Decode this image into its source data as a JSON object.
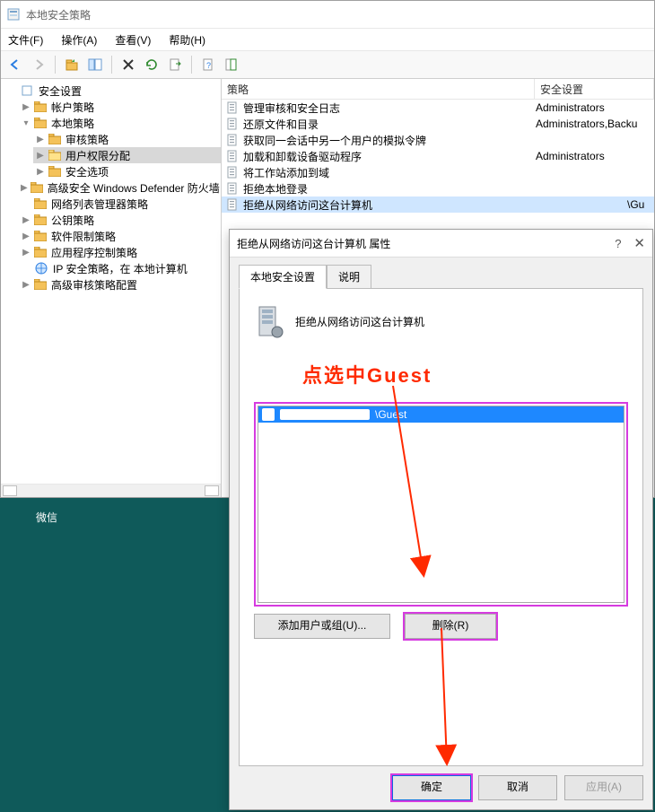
{
  "window": {
    "title": "本地安全策略",
    "menus": {
      "file": "文件(F)",
      "action": "操作(A)",
      "view": "查看(V)",
      "help": "帮助(H)"
    }
  },
  "tree": {
    "root": "安全设置",
    "accountPolicy": "帐户策略",
    "localPolicy": "本地策略",
    "auditPolicy": "审核策略",
    "userRights": "用户权限分配",
    "securityOptions": "安全选项",
    "defender": "高级安全 Windows Defender 防火墙",
    "netListMgr": "网络列表管理器策略",
    "publicKey": "公钥策略",
    "softRestrict": "软件限制策略",
    "appControl": "应用程序控制策略",
    "ipPolicy": "IP 安全策略，在 本地计算机",
    "advAudit": "高级审核策略配置"
  },
  "listHeader": {
    "policy": "策略",
    "setting": "安全设置"
  },
  "policies": [
    {
      "name": "管理审核和安全日志",
      "setting": "Administrators"
    },
    {
      "name": "还原文件和目录",
      "setting": "Administrators,Backu"
    },
    {
      "name": "获取同一会话中另一个用户的模拟令牌",
      "setting": ""
    },
    {
      "name": "加载和卸载设备驱动程序",
      "setting": "Administrators"
    },
    {
      "name": "将工作站添加到域",
      "setting": ""
    },
    {
      "name": "拒绝本地登录",
      "setting": ""
    }
  ],
  "selectedPolicy": {
    "name": "拒绝从网络访问这台计算机",
    "setting": "\\Gu"
  },
  "dialog": {
    "title": "拒绝从网络访问这台计算机 属性",
    "tab1": "本地安全设置",
    "tab2": "说明",
    "policyName": "拒绝从网络访问这台计算机",
    "selectedUser": "\\Guest",
    "addBtn": "添加用户或组(U)...",
    "deleteBtn": "删除(R)",
    "ok": "确定",
    "cancel": "取消",
    "apply": "应用(A)"
  },
  "taskbarItem": "微信",
  "annotation": "点选中Guest"
}
